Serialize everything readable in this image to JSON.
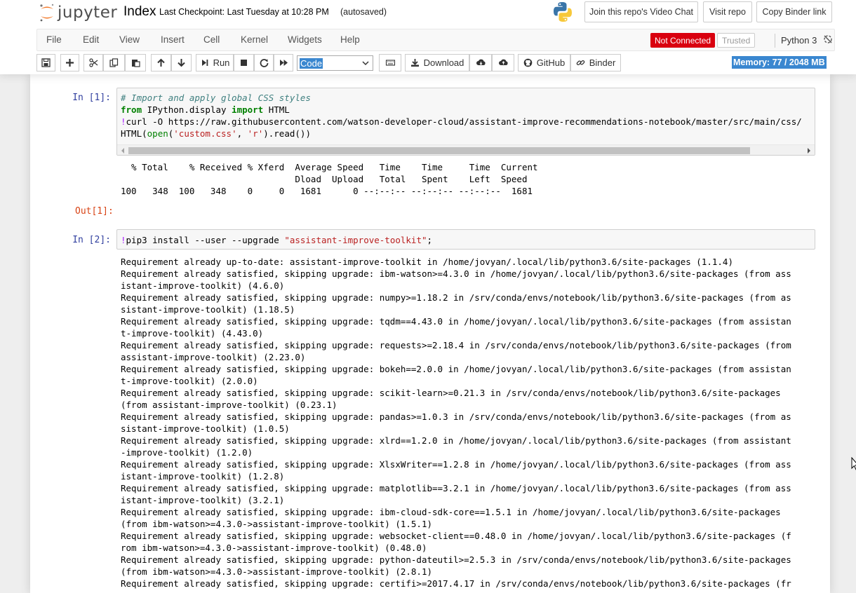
{
  "header": {
    "logo_text": "jupyter",
    "notebook_name": "Index",
    "checkpoint": "Last Checkpoint: Last Tuesday at 10:28 PM",
    "autosave": "(autosaved)",
    "buttons": {
      "video_chat": "Join this repo's Video Chat",
      "visit_repo": "Visit repo",
      "copy_binder": "Copy Binder link"
    }
  },
  "menubar": {
    "items": [
      "File",
      "Edit",
      "View",
      "Insert",
      "Cell",
      "Kernel",
      "Widgets",
      "Help"
    ],
    "status": "Not Connected",
    "trusted": "Trusted",
    "kernel": "Python 3"
  },
  "toolbar": {
    "run_label": "Run",
    "cell_type": "Code",
    "download_label": "Download",
    "github_label": "GitHub",
    "binder_label": "Binder",
    "memory": "Memory: 77 / 2048 MB"
  },
  "colors": {
    "accent": "#3a87d0",
    "not_connected": "#d9000f",
    "in_prompt": "#303f9f",
    "out_prompt": "#d84315"
  },
  "cells": [
    {
      "in_prompt": "In [1]:",
      "out_prompt": "Out[1]:",
      "code": {
        "comment": "# Import and apply global CSS styles",
        "line2_from": "from",
        "line2_mod": " IPython.display ",
        "line2_import": "import",
        "line2_name": " HTML",
        "line3_bang": "!",
        "line3_rest": "curl -O https://raw.githubusercontent.com/watson-developer-cloud/assistant-improve-recommendations-notebook/master/src/main/css/",
        "line4_a": "HTML(",
        "line4_open": "open",
        "line4_b": "(",
        "line4_s1": "'custom.css'",
        "line4_c": ", ",
        "line4_s2": "'r'",
        "line4_d": ").read())"
      },
      "output": [
        "  % Total    % Received % Xferd  Average Speed   Time    Time     Time  Current",
        "                                 Dload  Upload   Total   Spent    Left  Speed",
        "100   348  100   348    0     0   1681      0 --:--:-- --:--:-- --:--:--  1681"
      ]
    },
    {
      "in_prompt": "In [2]:",
      "code": {
        "bang": "!",
        "cmd": "pip3 install --user --upgrade ",
        "arg": "\"assistant-improve-toolkit\"",
        "end": ";"
      },
      "output": [
        "Requirement already up-to-date: assistant-improve-toolkit in /home/jovyan/.local/lib/python3.6/site-packages (1.1.4)",
        "Requirement already satisfied, skipping upgrade: ibm-watson>=4.3.0 in /home/jovyan/.local/lib/python3.6/site-packages (from ass",
        "istant-improve-toolkit) (4.6.0)",
        "Requirement already satisfied, skipping upgrade: numpy>=1.18.2 in /srv/conda/envs/notebook/lib/python3.6/site-packages (from as",
        "sistant-improve-toolkit) (1.18.5)",
        "Requirement already satisfied, skipping upgrade: tqdm==4.43.0 in /home/jovyan/.local/lib/python3.6/site-packages (from assistan",
        "t-improve-toolkit) (4.43.0)",
        "Requirement already satisfied, skipping upgrade: requests>=2.18.4 in /srv/conda/envs/notebook/lib/python3.6/site-packages (from",
        "assistant-improve-toolkit) (2.23.0)",
        "Requirement already satisfied, skipping upgrade: bokeh==2.0.0 in /home/jovyan/.local/lib/python3.6/site-packages (from assistan",
        "t-improve-toolkit) (2.0.0)",
        "Requirement already satisfied, skipping upgrade: scikit-learn>=0.21.3 in /srv/conda/envs/notebook/lib/python3.6/site-packages",
        "(from assistant-improve-toolkit) (0.23.1)",
        "Requirement already satisfied, skipping upgrade: pandas>=1.0.3 in /srv/conda/envs/notebook/lib/python3.6/site-packages (from as",
        "sistant-improve-toolkit) (1.0.5)",
        "Requirement already satisfied, skipping upgrade: xlrd==1.2.0 in /home/jovyan/.local/lib/python3.6/site-packages (from assistant",
        "-improve-toolkit) (1.2.0)",
        "Requirement already satisfied, skipping upgrade: XlsxWriter==1.2.8 in /home/jovyan/.local/lib/python3.6/site-packages (from ass",
        "istant-improve-toolkit) (1.2.8)",
        "Requirement already satisfied, skipping upgrade: matplotlib==3.2.1 in /home/jovyan/.local/lib/python3.6/site-packages (from ass",
        "istant-improve-toolkit) (3.2.1)",
        "Requirement already satisfied, skipping upgrade: ibm-cloud-sdk-core==1.5.1 in /home/jovyan/.local/lib/python3.6/site-packages",
        "(from ibm-watson>=4.3.0->assistant-improve-toolkit) (1.5.1)",
        "Requirement already satisfied, skipping upgrade: websocket-client==0.48.0 in /home/jovyan/.local/lib/python3.6/site-packages (f",
        "rom ibm-watson>=4.3.0->assistant-improve-toolkit) (0.48.0)",
        "Requirement already satisfied, skipping upgrade: python-dateutil>=2.5.3 in /srv/conda/envs/notebook/lib/python3.6/site-packages",
        "(from ibm-watson>=4.3.0->assistant-improve-toolkit) (2.8.1)",
        "Requirement already satisfied, skipping upgrade: certifi>=2017.4.17 in /srv/conda/envs/notebook/lib/python3.6/site-packages (fr"
      ]
    }
  ]
}
